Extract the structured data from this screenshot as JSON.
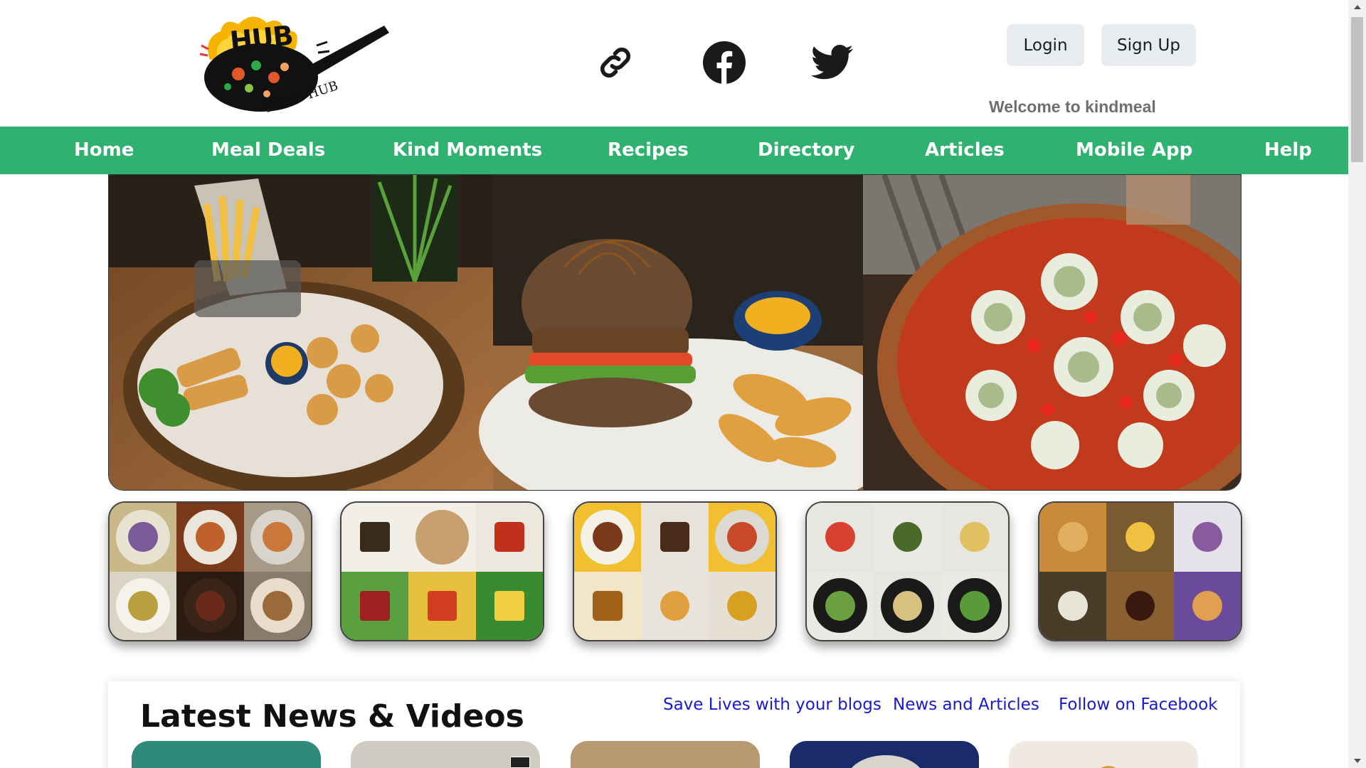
{
  "header": {
    "logo": {
      "wordmark": "HUB",
      "subtitle": "FOOD HUB",
      "icon": "frying-pan-logo"
    },
    "social_links": [
      {
        "name": "link-icon"
      },
      {
        "name": "facebook-icon"
      },
      {
        "name": "twitter-icon"
      }
    ],
    "login_label": "Login",
    "signup_label": "Sign Up",
    "welcome_text": "Welcome to kindmeal"
  },
  "nav": {
    "items": [
      {
        "label": "Home"
      },
      {
        "label": "Meal Deals"
      },
      {
        "label": "Kind Moments"
      },
      {
        "label": "Recipes"
      },
      {
        "label": "Directory"
      },
      {
        "label": "Articles"
      },
      {
        "label": "Mobile App"
      },
      {
        "label": "Help"
      }
    ]
  },
  "hero": {
    "image": "banner-fries-burger-pizza"
  },
  "tiles": [
    {
      "image": "tile-asian-dishes-collage"
    },
    {
      "image": "tile-packaged-products-collage"
    },
    {
      "image": "tile-cafe-food-collage"
    },
    {
      "image": "tile-salad-spread"
    },
    {
      "image": "tile-desserts-collage"
    }
  ],
  "news": {
    "title": "Latest News & Videos",
    "links": [
      {
        "label": "Save Lives with your blogs"
      },
      {
        "label": "News and Articles"
      },
      {
        "label": "Follow on Facebook"
      }
    ]
  },
  "colors": {
    "nav_bg": "#2fb26f",
    "nav_text": "#ffffff",
    "button_bg": "#e8ecf1",
    "link_blue": "#1a1acc",
    "welcome_grey": "#6f6f6f"
  }
}
